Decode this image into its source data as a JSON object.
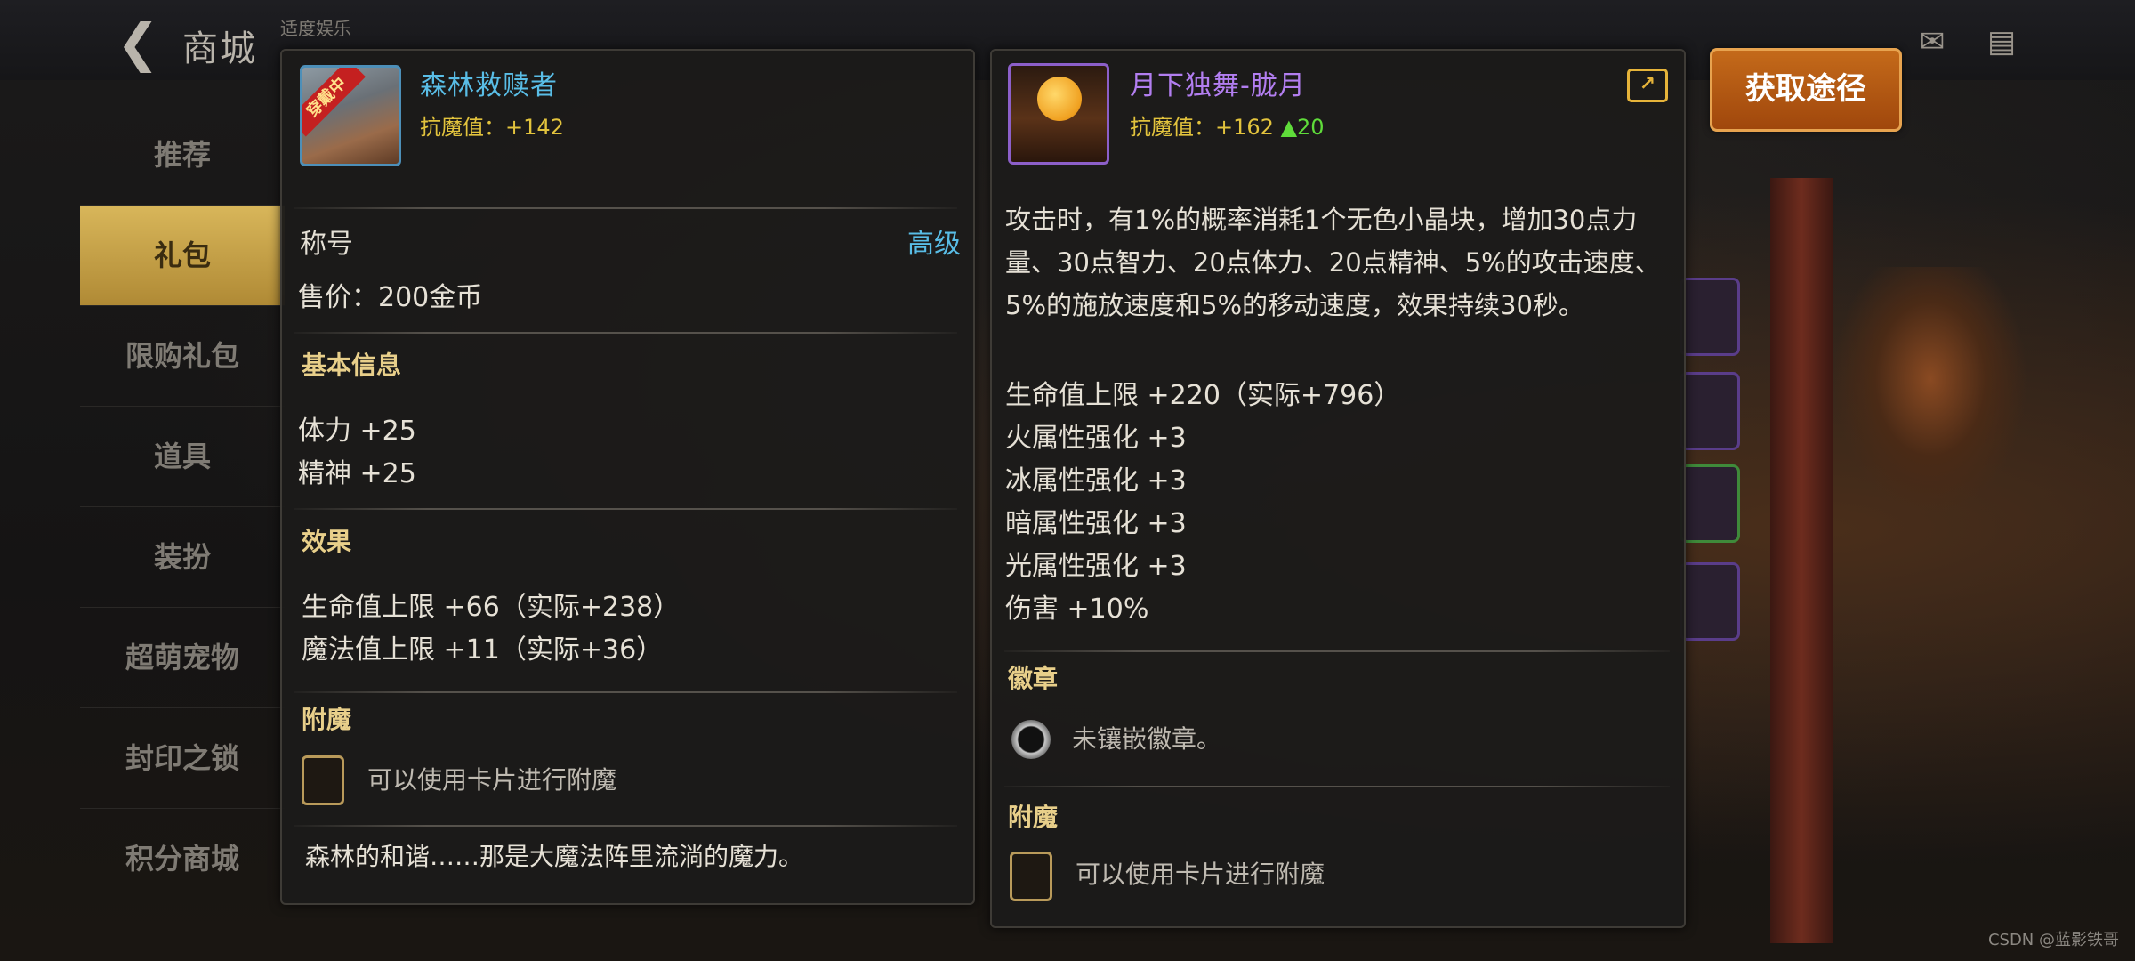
{
  "header": {
    "back_icon": "back-arrow-icon",
    "title": "商城",
    "hint": "适度娱乐"
  },
  "sidebar": {
    "items": [
      {
        "label": "推荐",
        "active": false
      },
      {
        "label": "礼包",
        "active": true
      },
      {
        "label": "限购礼包",
        "active": false
      },
      {
        "label": "道具",
        "active": false
      },
      {
        "label": "装扮",
        "active": false
      },
      {
        "label": "超萌宠物",
        "active": false
      },
      {
        "label": "封印之锁",
        "active": false
      },
      {
        "label": "积分商城",
        "active": false
      }
    ]
  },
  "left_panel": {
    "item_name": "森林救赎者",
    "name_color": "#59bde6",
    "equipped_badge": "穿戴中",
    "stat": "抗魔值：+142",
    "type_label": "称号",
    "grade": "高级",
    "price": "售价：200金币",
    "basic_title": "基本信息",
    "basic": [
      "体力 +25",
      "精神 +25"
    ],
    "effect_title": "效果",
    "effects": [
      "生命值上限 +66（实际+238）",
      "魔法值上限 +11（实际+36）"
    ],
    "enchant_title": "附魔",
    "enchant_hint": "可以使用卡片进行附魔",
    "flavor": "森林的和谐……那是大魔法阵里流淌的魔力。"
  },
  "right_panel": {
    "item_name": "月下独舞-胧月",
    "name_color": "#b27ef0",
    "stat": "抗魔值：+162",
    "stat_up": "▲20",
    "description": "攻击时，有1%的概率消耗1个无色小晶块，增加30点力量、30点智力、20点体力、20点精神、5%的攻击速度、5%的施放速度和5%的移动速度，效果持续30秒。",
    "stats": [
      "生命值上限 +220（实际+796）",
      "火属性强化 +3",
      "冰属性强化 +3",
      "暗属性强化 +3",
      "光属性强化 +3",
      "伤害 +10%"
    ],
    "emblem_title": "徽章",
    "emblem_hint": "未镶嵌徽章。",
    "enchant_title": "附魔",
    "enchant_hint": "可以使用卡片进行附魔",
    "share_icon": "share-icon"
  },
  "obtain_button": "获取途径",
  "watermark": "CSDN @蓝影铁哥"
}
